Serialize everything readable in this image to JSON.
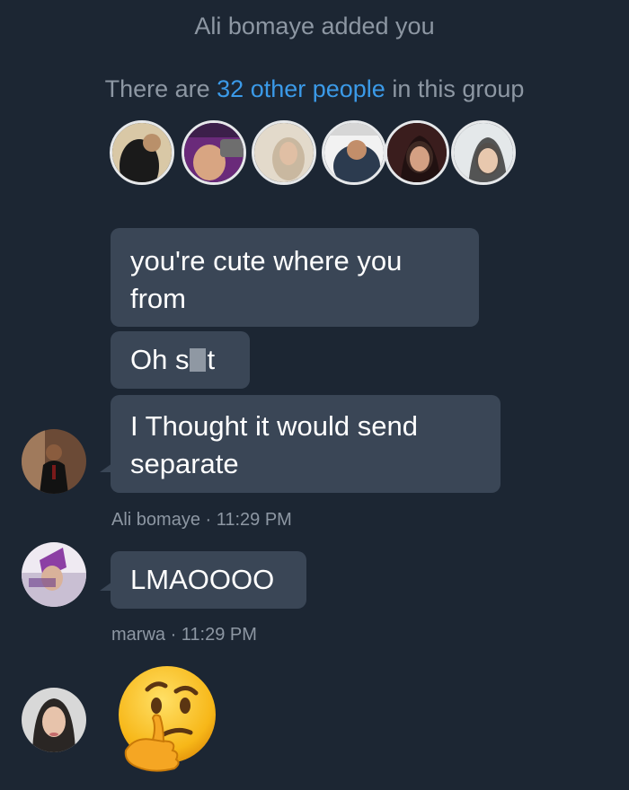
{
  "system": {
    "added": "Ali bomaye added you",
    "group_prefix": "There are ",
    "group_link": "32 other people",
    "group_suffix": " in this group"
  },
  "member_avatars": [
    {
      "icon": "member-photo-1-icon"
    },
    {
      "icon": "member-photo-2-icon"
    },
    {
      "icon": "member-photo-3-icon"
    },
    {
      "icon": "member-photo-4-icon"
    },
    {
      "icon": "member-photo-5-icon"
    },
    {
      "icon": "member-photo-6-icon"
    }
  ],
  "messages": {
    "m1_line1": "you're cute where you",
    "m1_line2": "from",
    "m2_a": "Oh s",
    "m2_b": "t",
    "m3_line1": "I Thought it would send",
    "m3_line2": "separate",
    "meta1": "Ali bomaye · 11:29 PM",
    "m4": "LMAOOOO",
    "meta2": "marwa · 11:29 PM"
  },
  "colors": {
    "background": "#1c2633",
    "bubble": "#3a4656",
    "link": "#3b9ae8",
    "muted_text": "#8d97a3"
  }
}
